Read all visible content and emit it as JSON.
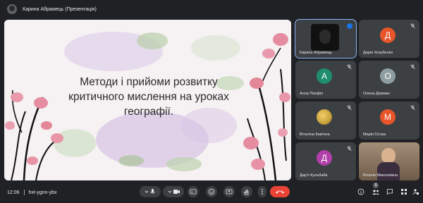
{
  "presenter": {
    "label": "Карина Абрамець (Презентація)"
  },
  "slide": {
    "title": "Методи і прийоми розвитку критичного мислення на уроках географії."
  },
  "participants": [
    {
      "name": "Карина Абрамець",
      "type": "video",
      "active": true
    },
    {
      "name": "Дарія Хозубенко",
      "initial": "Д",
      "color": "#e8552b"
    },
    {
      "name": "Анна Панфіл",
      "initial": "А",
      "color": "#1e8e6e"
    },
    {
      "name": "Олена Дерман",
      "initial": "О",
      "color": "#8e9ea0"
    },
    {
      "name": "Віталіна Кам'яна",
      "type": "photo"
    },
    {
      "name": "Марія Остра",
      "initial": "М",
      "color": "#e8552b"
    },
    {
      "name": "Дар'я Кульбаба",
      "initial": "Д",
      "color": "#b13fa8"
    },
    {
      "name": "Віталія Миколаївна",
      "type": "video2"
    }
  ],
  "meeting": {
    "time": "12:06",
    "code": "hxt-ygnn-ybx"
  },
  "people_count": "9",
  "colors": {
    "end_call": "#ea4335",
    "accent": "#8ab4f8",
    "background": "#202124",
    "tile": "#3c4043"
  }
}
